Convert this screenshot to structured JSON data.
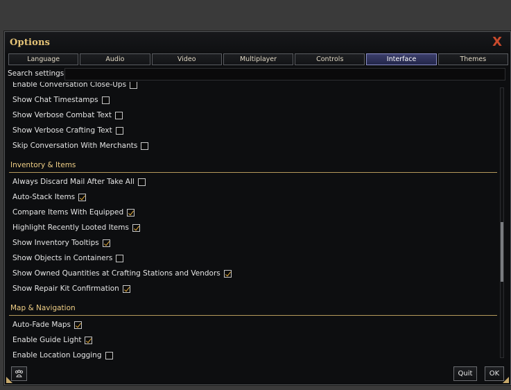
{
  "window": {
    "title": "Options",
    "close_glyph": "X"
  },
  "tabs": [
    {
      "label": "Language",
      "active": false
    },
    {
      "label": "Audio",
      "active": false
    },
    {
      "label": "Video",
      "active": false
    },
    {
      "label": "Multiplayer",
      "active": false
    },
    {
      "label": "Controls",
      "active": false
    },
    {
      "label": "Interface",
      "active": true
    },
    {
      "label": "Themes",
      "active": false
    }
  ],
  "search": {
    "label": "Search settings",
    "value": ""
  },
  "groups": {
    "chat": {
      "items": [
        {
          "label": "Enable Conversation Close-Ups",
          "checked": false
        },
        {
          "label": "Show Chat Timestamps",
          "checked": false
        },
        {
          "label": "Show Verbose Combat Text",
          "checked": false
        },
        {
          "label": "Show Verbose Crafting Text",
          "checked": false
        },
        {
          "label": "Skip Conversation With Merchants",
          "checked": false
        }
      ]
    },
    "inventory": {
      "title": "Inventory & Items",
      "items": [
        {
          "label": "Always Discard Mail After Take All",
          "checked": false
        },
        {
          "label": "Auto-Stack Items",
          "checked": true
        },
        {
          "label": "Compare Items With Equipped",
          "checked": true
        },
        {
          "label": "Highlight Recently Looted Items",
          "checked": true
        },
        {
          "label": "Show Inventory Tooltips",
          "checked": true
        },
        {
          "label": "Show Objects in Containers",
          "checked": false
        },
        {
          "label": "Show Owned Quantities at Crafting Stations and Vendors",
          "checked": true
        },
        {
          "label": "Show Repair Kit Confirmation",
          "checked": true
        }
      ]
    },
    "map": {
      "title": "Map & Navigation",
      "items": [
        {
          "label": "Auto-Fade Maps",
          "checked": true
        },
        {
          "label": "Enable Guide Light",
          "checked": true
        },
        {
          "label": "Enable Location Logging",
          "checked": false
        }
      ]
    }
  },
  "footer": {
    "quit_label": "Quit",
    "ok_label": "OK",
    "icon": "paw-icon"
  },
  "colors": {
    "accent": "#e6c477",
    "active_tab": "#2f3259",
    "close": "#c94a2c"
  }
}
